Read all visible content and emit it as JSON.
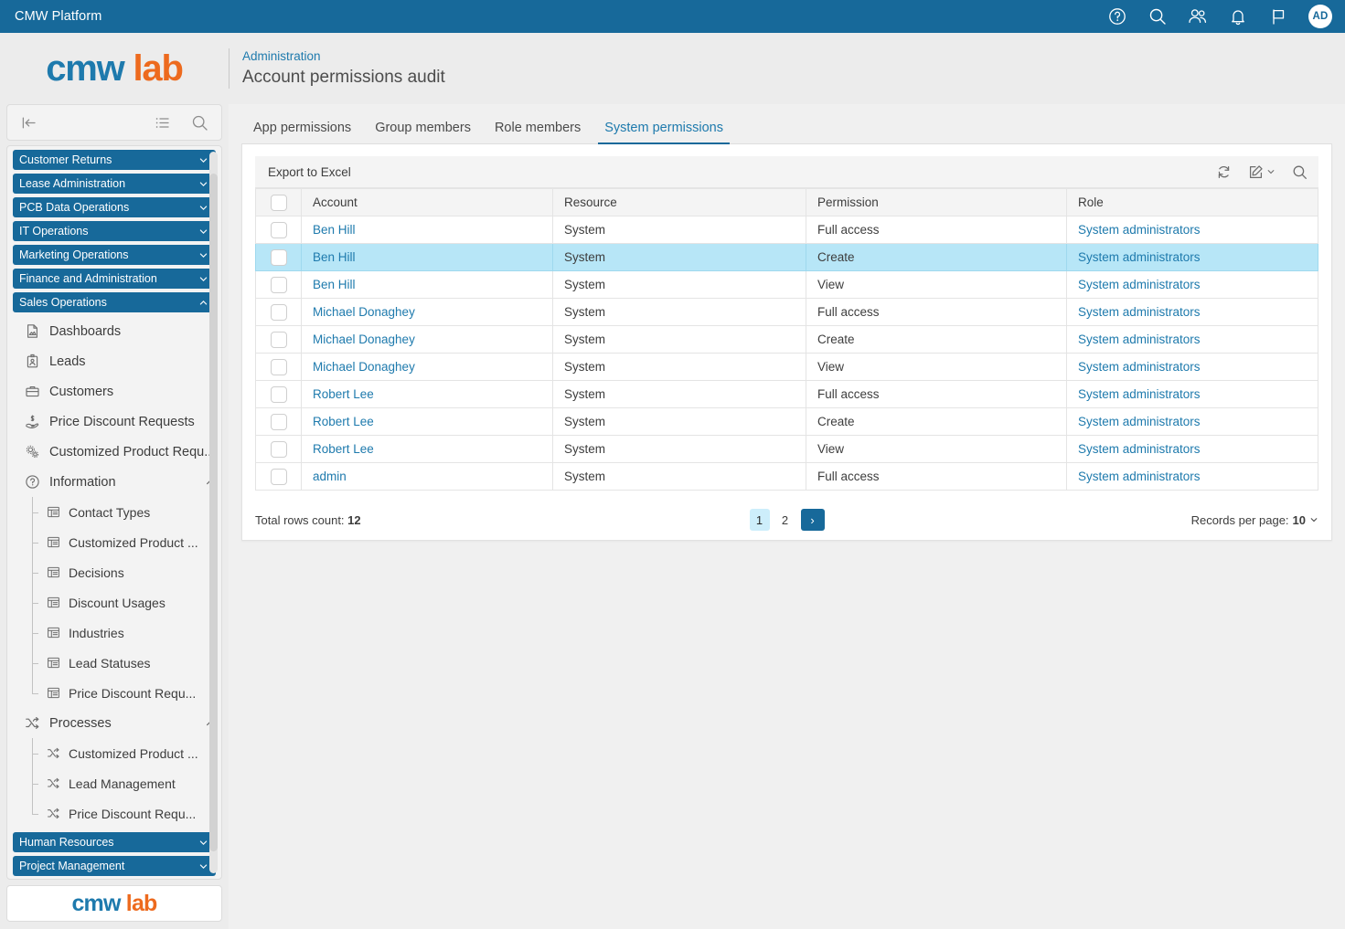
{
  "topbar": {
    "title": "CMW Platform",
    "icons": [
      "help-circle-icon",
      "search-icon",
      "users-icon",
      "bell-icon",
      "flag-icon"
    ],
    "avatar_initials": "AD"
  },
  "brand": {
    "part1": "cmw",
    "part2": "lab"
  },
  "header": {
    "breadcrumb": "Administration",
    "page_title": "Account permissions audit"
  },
  "sidebar": {
    "toolbar": [
      "collapse-left-icon",
      "list-icon",
      "search-icon"
    ],
    "sections_top": [
      {
        "label": "Customer Returns",
        "expanded": false
      },
      {
        "label": "Lease Administration",
        "expanded": false
      },
      {
        "label": "PCB Data Operations",
        "expanded": false
      },
      {
        "label": "IT Operations",
        "expanded": false
      },
      {
        "label": "Marketing Operations",
        "expanded": false
      },
      {
        "label": "Finance and Administration",
        "expanded": false
      },
      {
        "label": "Sales Operations",
        "expanded": true
      }
    ],
    "items": [
      {
        "label": "Dashboards",
        "icon": "document-icon"
      },
      {
        "label": "Leads",
        "icon": "id-badge-icon"
      },
      {
        "label": "Customers",
        "icon": "briefcase-icon"
      },
      {
        "label": "Price Discount Requests",
        "icon": "hand-money-icon"
      },
      {
        "label": "Customized Product Requ...",
        "icon": "gears-icon"
      }
    ],
    "group_information": {
      "label": "Information",
      "icon": "question-circle-icon",
      "items": [
        {
          "label": "Contact Types",
          "icon": "table-icon"
        },
        {
          "label": "Customized Product ...",
          "icon": "table-icon"
        },
        {
          "label": "Decisions",
          "icon": "table-icon"
        },
        {
          "label": "Discount Usages",
          "icon": "table-icon"
        },
        {
          "label": "Industries",
          "icon": "table-icon"
        },
        {
          "label": "Lead Statuses",
          "icon": "table-icon"
        },
        {
          "label": "Price Discount Requ...",
          "icon": "table-icon"
        }
      ]
    },
    "group_processes": {
      "label": "Processes",
      "icon": "shuffle-icon",
      "items": [
        {
          "label": "Customized Product ...",
          "icon": "shuffle-icon"
        },
        {
          "label": "Lead Management",
          "icon": "shuffle-icon"
        },
        {
          "label": "Price Discount Requ...",
          "icon": "shuffle-icon"
        }
      ]
    },
    "sections_bottom": [
      {
        "label": "Human Resources",
        "expanded": false
      },
      {
        "label": "Project Management",
        "expanded": false
      }
    ]
  },
  "tabs": [
    {
      "label": "App permissions",
      "active": false
    },
    {
      "label": "Group members",
      "active": false
    },
    {
      "label": "Role members",
      "active": false
    },
    {
      "label": "System permissions",
      "active": true
    }
  ],
  "toolbar": {
    "export_label": "Export to Excel",
    "icons": [
      "refresh-icon",
      "edit-icon",
      "chevron-down-icon",
      "search-icon"
    ]
  },
  "table": {
    "columns": [
      "Account",
      "Resource",
      "Permission",
      "Role"
    ],
    "rows": [
      {
        "account": "Ben Hill",
        "resource": "System",
        "permission": "Full access",
        "role": "System administrators",
        "selected": false
      },
      {
        "account": "Ben Hill",
        "resource": "System",
        "permission": "Create",
        "role": "System administrators",
        "selected": true
      },
      {
        "account": "Ben Hill",
        "resource": "System",
        "permission": "View",
        "role": "System administrators",
        "selected": false
      },
      {
        "account": "Michael Donaghey",
        "resource": "System",
        "permission": "Full access",
        "role": "System administrators",
        "selected": false
      },
      {
        "account": "Michael Donaghey",
        "resource": "System",
        "permission": "Create",
        "role": "System administrators",
        "selected": false
      },
      {
        "account": "Michael Donaghey",
        "resource": "System",
        "permission": "View",
        "role": "System administrators",
        "selected": false
      },
      {
        "account": "Robert Lee",
        "resource": "System",
        "permission": "Full access",
        "role": "System administrators",
        "selected": false
      },
      {
        "account": "Robert Lee",
        "resource": "System",
        "permission": "Create",
        "role": "System administrators",
        "selected": false
      },
      {
        "account": "Robert Lee",
        "resource": "System",
        "permission": "View",
        "role": "System administrators",
        "selected": false
      },
      {
        "account": "admin",
        "resource": "System",
        "permission": "Full access",
        "role": "System administrators",
        "selected": false
      }
    ]
  },
  "pager": {
    "total_label": "Total rows count:",
    "total_value": "12",
    "pages": [
      "1",
      "2"
    ],
    "active_page": "1",
    "next_glyph": "›",
    "rpp_label": "Records per page:",
    "rpp_value": "10"
  },
  "colors": {
    "brand_blue": "#17699a",
    "link_blue": "#1e7aad",
    "accent_orange": "#ed6a1e",
    "row_selected": "#b7e6f7",
    "page_active": "#cdeefb"
  }
}
